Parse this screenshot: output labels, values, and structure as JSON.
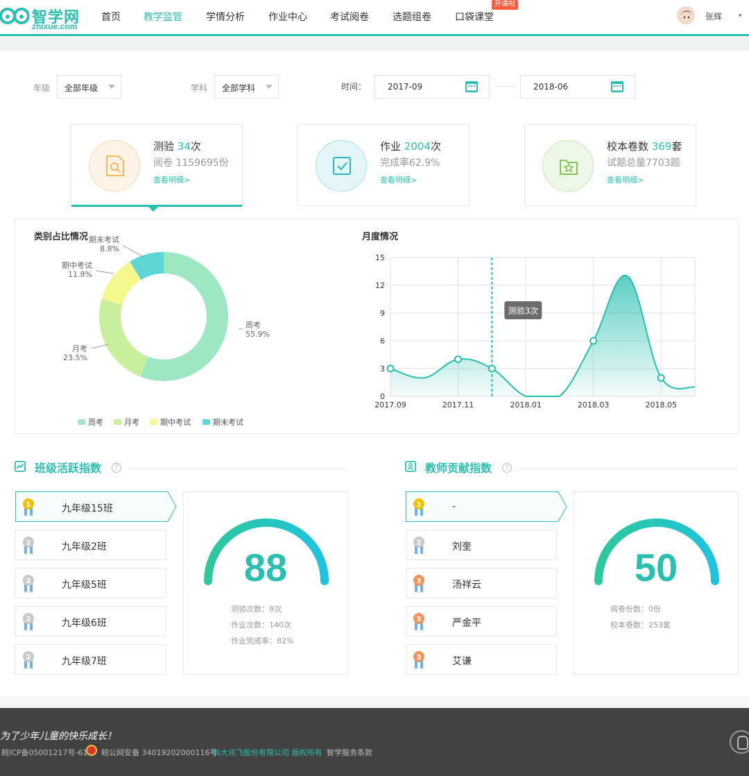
{
  "logo": {
    "cn": "智学网",
    "en": "zhixue.com"
  },
  "nav": {
    "items": [
      "首页",
      "教学监管",
      "学情分析",
      "作业中心",
      "考试阅卷",
      "选题组卷",
      "口袋课堂"
    ],
    "active_index": 1,
    "badge": "开课啦"
  },
  "user": {
    "name": "张辉",
    "caret": "▾"
  },
  "filters": {
    "grade_label": "年级",
    "grade_value": "全部年级",
    "subject_label": "学科",
    "subject_value": "全部学科",
    "time_label": "时间：",
    "start": "2017-09",
    "end": "2018-06"
  },
  "cards": [
    {
      "title": "测验",
      "num": "34",
      "unit": "次",
      "sub": "阅卷 1159695份",
      "link": "查看明细>",
      "color": "#f5b85a",
      "bg": "#fdf3e6"
    },
    {
      "title": "作业",
      "num": "2004",
      "unit": "次",
      "sub": "完成率62.9%",
      "link": "查看明细>",
      "color": "#26b7c4",
      "bg": "#e4f6f8"
    },
    {
      "title": "校本卷数",
      "num": "369",
      "unit": "套",
      "sub": "试题总量7703题",
      "link": "查看明细>",
      "color": "#7cc652",
      "bg": "#eef8e8"
    }
  ],
  "pie": {
    "title": "类别占比情况",
    "slices": [
      {
        "name": "周考",
        "pct": "55.9%",
        "value": 55.9,
        "color": "#9ee7c3"
      },
      {
        "name": "月考",
        "pct": "23.5%",
        "value": 23.5,
        "color": "#c8ef9b"
      },
      {
        "name": "期中考试",
        "pct": "11.8%",
        "value": 11.8,
        "color": "#f5f88d"
      },
      {
        "name": "期末考试",
        "pct": "8.8%",
        "value": 8.8,
        "color": "#5fd6d6"
      }
    ]
  },
  "line": {
    "title": "月度情况",
    "y_ticks": [
      "0",
      "3",
      "6",
      "9",
      "12",
      "15"
    ],
    "x_ticks": [
      "2017.09",
      "2017.11",
      "2018.01",
      "2018.03",
      "2018.05"
    ],
    "points": [
      [
        0,
        3
      ],
      [
        1,
        2
      ],
      [
        2,
        4
      ],
      [
        3,
        3
      ],
      [
        4,
        0
      ],
      [
        5,
        0
      ],
      [
        6,
        6
      ],
      [
        7,
        13
      ],
      [
        8,
        2
      ],
      [
        9,
        1
      ]
    ],
    "markers": [
      0,
      2,
      3,
      6,
      8
    ],
    "tooltip": "测验3次",
    "tooltip_index": 3,
    "color": "#26bfae"
  },
  "class_index": {
    "title": "班级活跃指数",
    "help": "?",
    "items": [
      {
        "rank": "1",
        "name": "九年级15班"
      },
      {
        "rank": "2",
        "name": "九年级2班"
      },
      {
        "rank": "2",
        "name": "九年级5班"
      },
      {
        "rank": "2",
        "name": "九年级6班"
      },
      {
        "rank": "2",
        "name": "九年级7班"
      }
    ],
    "score": "88",
    "score_value": 88,
    "stats": [
      "测验次数：9次",
      "作业次数：140次",
      "作业完成率：82%"
    ]
  },
  "teacher_index": {
    "title": "教师贡献指数",
    "help": "?",
    "items": [
      {
        "rank": "1",
        "name": "-"
      },
      {
        "rank": "2",
        "name": "刘奎"
      },
      {
        "rank": "3",
        "name": "汤祥云"
      },
      {
        "rank": "3",
        "name": "严金平"
      },
      {
        "rank": "3",
        "name": "艾谦"
      }
    ],
    "score": "50",
    "score_value": 50,
    "stats": [
      "阅卷份数：0份",
      "校本卷数：253套"
    ]
  },
  "footer": {
    "slogan": "为了少年儿童的快乐成长！",
    "icp": "皖ICP备05001217号-61",
    "police": "皖公网安备 34019202000116号",
    "company": "科大讯飞股份有限公司 版权所有",
    "terms": "智学服务条款"
  },
  "colors": {
    "accent": "#2bbfb0",
    "gold": "#f2c200",
    "silver": "#c9c9c9",
    "bronze": "#f0955a"
  }
}
